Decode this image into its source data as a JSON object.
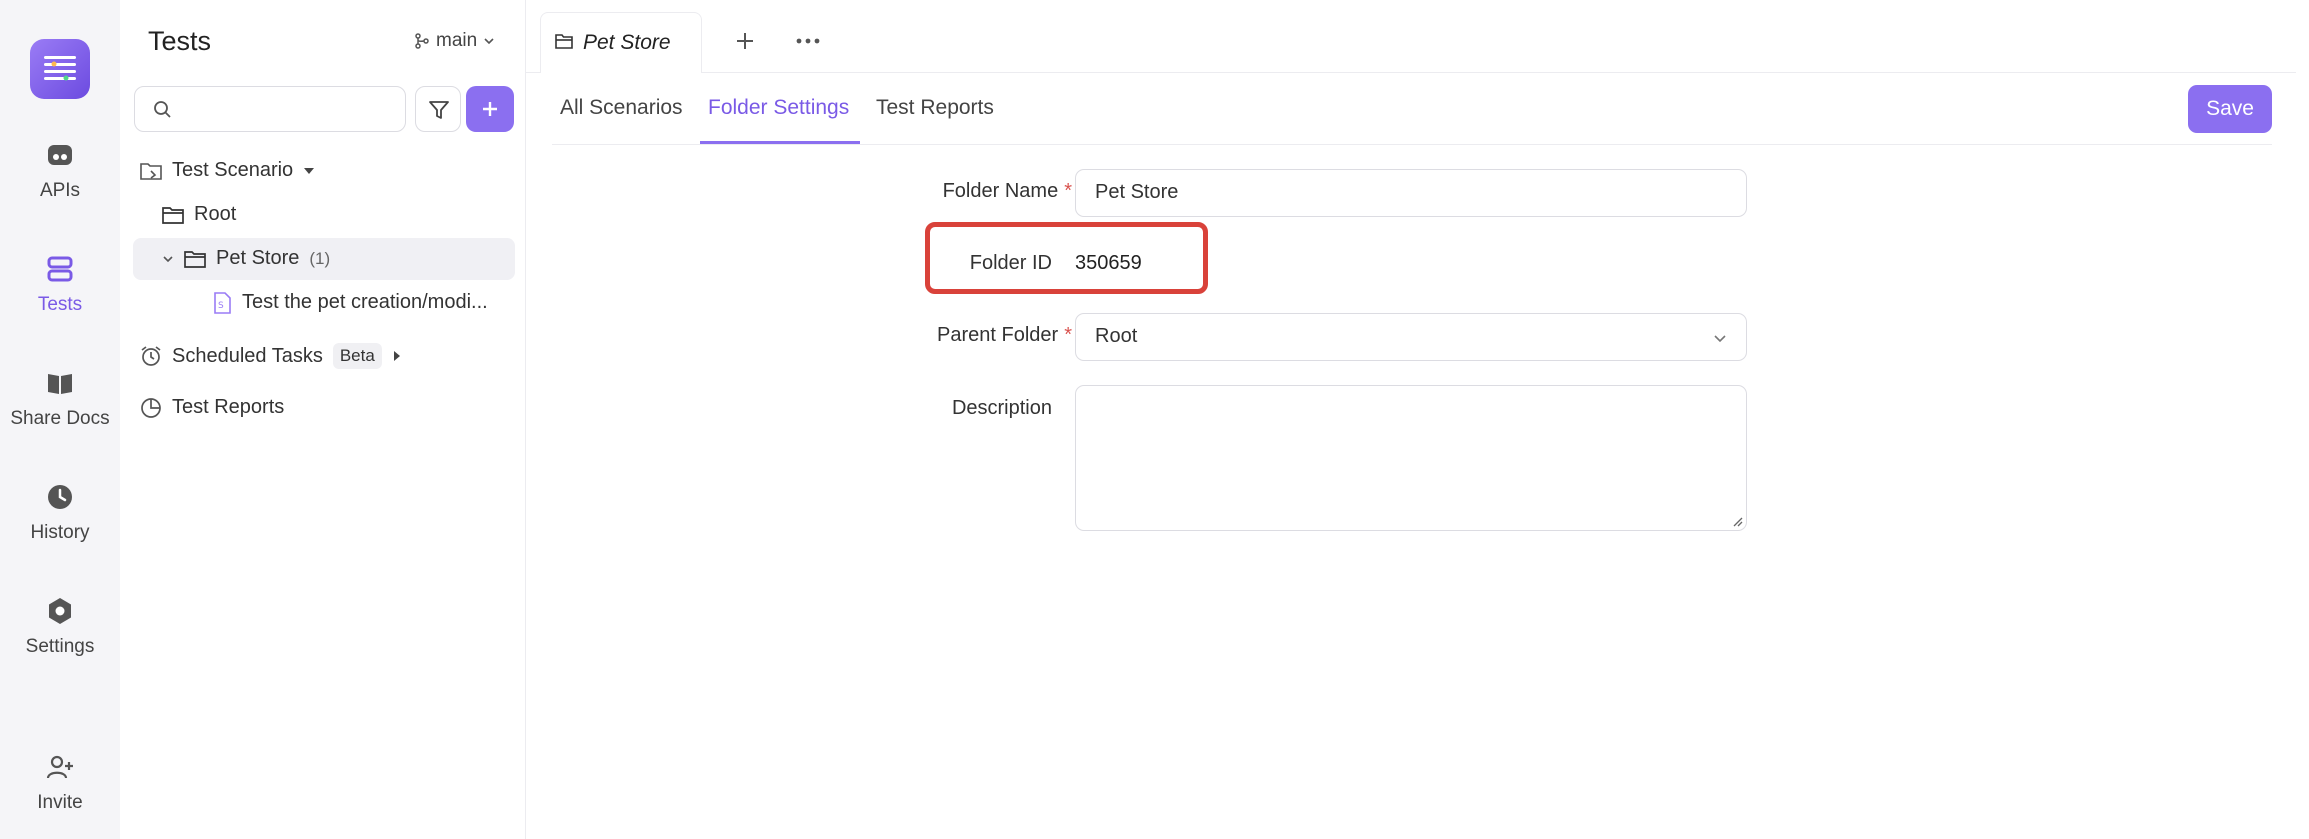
{
  "rail": {
    "items": [
      {
        "label": "APIs",
        "icon": "api-icon"
      },
      {
        "label": "Tests",
        "icon": "tests-icon"
      },
      {
        "label": "Share Docs",
        "icon": "book-icon"
      },
      {
        "label": "History",
        "icon": "clock-icon"
      },
      {
        "label": "Settings",
        "icon": "gear-icon"
      },
      {
        "label": "Invite",
        "icon": "add-user-icon"
      }
    ]
  },
  "tree": {
    "title": "Tests",
    "branch": "main",
    "search_placeholder": "",
    "scenario_label": "Test Scenario",
    "root_label": "Root",
    "folder_label": "Pet Store",
    "folder_count": "(1)",
    "test_label": "Test the pet creation/modi...",
    "scheduled_label": "Scheduled Tasks",
    "scheduled_badge": "Beta",
    "reports_label": "Test Reports"
  },
  "tabbar": {
    "open_tab": "Pet Store"
  },
  "subtabs": {
    "items": [
      "All Scenarios",
      "Folder Settings",
      "Test Reports"
    ],
    "active": "Folder Settings",
    "save_label": "Save"
  },
  "form": {
    "folder_name_label": "Folder Name",
    "folder_name_value": "Pet Store",
    "folder_id_label": "Folder ID",
    "folder_id_value": "350659",
    "parent_folder_label": "Parent Folder",
    "parent_folder_value": "Root",
    "description_label": "Description",
    "description_value": "",
    "required_mark": "*"
  },
  "colors": {
    "accent": "#8b6ff0",
    "highlight": "#d9423a",
    "required": "#d9534f"
  }
}
